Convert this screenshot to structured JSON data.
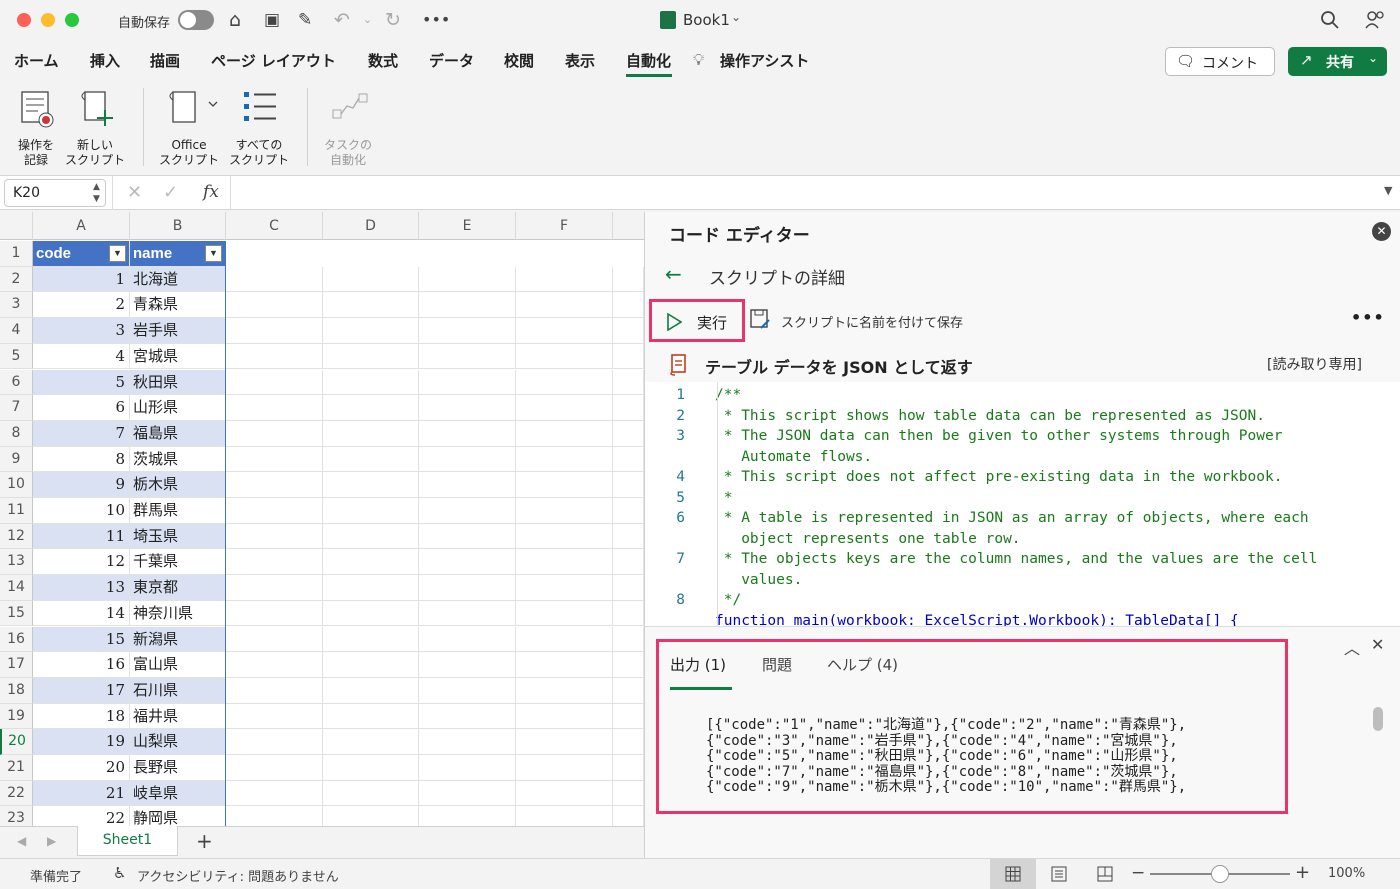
{
  "window": {
    "autosave_label": "自動保存",
    "doc_title": "Book1"
  },
  "tabs": [
    "ホーム",
    "挿入",
    "描画",
    "ページ レイアウト",
    "数式",
    "データ",
    "校閲",
    "表示",
    "自動化",
    "操作アシスト"
  ],
  "active_tab": "自動化",
  "header_buttons": {
    "comment": "コメント",
    "share": "共有"
  },
  "ribbon": {
    "record_l1": "操作を",
    "record_l2": "記録",
    "newscript_l1": "新しい",
    "newscript_l2": "スクリプト",
    "office_l1": "Office",
    "office_l2": "スクリプト",
    "all_l1": "すべての",
    "all_l2": "スクリプト",
    "task_l1": "タスクの",
    "task_l2": "自動化"
  },
  "formula_bar": {
    "name_box": "K20",
    "fx": "fx",
    "formula": ""
  },
  "sheet": {
    "columns": [
      "A",
      "B",
      "C",
      "D",
      "E",
      "F"
    ],
    "header_row": {
      "code": "code",
      "name": "name"
    },
    "rows": [
      {
        "n": "2",
        "code": "1",
        "name": "北海道"
      },
      {
        "n": "3",
        "code": "2",
        "name": "青森県"
      },
      {
        "n": "4",
        "code": "3",
        "name": "岩手県"
      },
      {
        "n": "5",
        "code": "4",
        "name": "宮城県"
      },
      {
        "n": "6",
        "code": "5",
        "name": "秋田県"
      },
      {
        "n": "7",
        "code": "6",
        "name": "山形県"
      },
      {
        "n": "8",
        "code": "7",
        "name": "福島県"
      },
      {
        "n": "9",
        "code": "8",
        "name": "茨城県"
      },
      {
        "n": "10",
        "code": "9",
        "name": "栃木県"
      },
      {
        "n": "11",
        "code": "10",
        "name": "群馬県"
      },
      {
        "n": "12",
        "code": "11",
        "name": "埼玉県"
      },
      {
        "n": "13",
        "code": "12",
        "name": "千葉県"
      },
      {
        "n": "14",
        "code": "13",
        "name": "東京都"
      },
      {
        "n": "15",
        "code": "14",
        "name": "神奈川県"
      },
      {
        "n": "16",
        "code": "15",
        "name": "新潟県"
      },
      {
        "n": "17",
        "code": "16",
        "name": "富山県"
      },
      {
        "n": "18",
        "code": "17",
        "name": "石川県"
      },
      {
        "n": "19",
        "code": "18",
        "name": "福井県"
      },
      {
        "n": "20",
        "code": "19",
        "name": "山梨県"
      },
      {
        "n": "21",
        "code": "20",
        "name": "長野県"
      },
      {
        "n": "22",
        "code": "21",
        "name": "岐阜県"
      },
      {
        "n": "23",
        "code": "22",
        "name": "静岡県"
      }
    ],
    "tab_name": "Sheet1"
  },
  "editor": {
    "title": "コード エディター",
    "subtitle": "スクリプトの詳細",
    "run": "実行",
    "save_as": "スクリプトに名前を付けて保存",
    "script_name": "テーブル データを JSON として返す",
    "readonly": "[読み取り専用]",
    "code": [
      {
        "n": "1",
        "t": "/**"
      },
      {
        "n": "2",
        "t": " * This script shows how table data can be represented as JSON."
      },
      {
        "n": "3",
        "t": " * The JSON data can then be given to other systems through Power"
      },
      {
        "n": "",
        "t": "   Automate flows."
      },
      {
        "n": "4",
        "t": " * This script does not affect pre-existing data in the workbook."
      },
      {
        "n": "5",
        "t": " *"
      },
      {
        "n": "6",
        "t": " * A table is represented in JSON as an array of objects, where each"
      },
      {
        "n": "",
        "t": "   object represents one table row."
      },
      {
        "n": "7",
        "t": " * The objects keys are the column names, and the values are the cell"
      },
      {
        "n": "",
        "t": "   values."
      },
      {
        "n": "8",
        "t": " */"
      }
    ],
    "code_partial": "function main(workbook: ExcelScript.Workbook): TableData[] {",
    "output_tabs": [
      "出力 (1)",
      "問題",
      "ヘルプ (4)"
    ],
    "output_lines": [
      "[{\"code\":\"1\",\"name\":\"北海道\"},{\"code\":\"2\",\"name\":\"青森県\"},",
      "{\"code\":\"3\",\"name\":\"岩手県\"},{\"code\":\"4\",\"name\":\"宮城県\"},",
      "{\"code\":\"5\",\"name\":\"秋田県\"},{\"code\":\"6\",\"name\":\"山形県\"},",
      "{\"code\":\"7\",\"name\":\"福島県\"},{\"code\":\"8\",\"name\":\"茨城県\"},",
      "{\"code\":\"9\",\"name\":\"栃木県\"},{\"code\":\"10\",\"name\":\"群馬県\"},"
    ]
  },
  "status": {
    "ready": "準備完了",
    "accessibility": "アクセシビリティ: 問題ありません",
    "zoom": "100%",
    "zoom_level": 0.5
  },
  "colors": {
    "accent_green": "#107c41",
    "table_header": "#4472c4",
    "band": "#d9e1f2",
    "highlight": "#e8336b"
  }
}
